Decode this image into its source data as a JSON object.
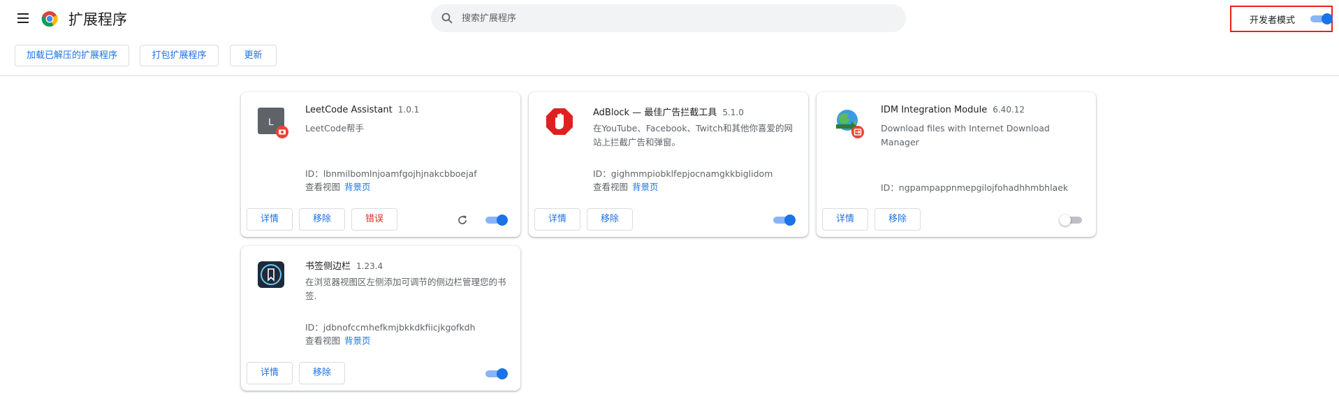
{
  "header": {
    "title": "扩展程序",
    "search_placeholder": "搜索扩展程序",
    "dev_mode_label": "开发者模式",
    "dev_mode_on": true
  },
  "toolbar": {
    "load_unpacked": "加载已解压的扩展程序",
    "pack": "打包扩展程序",
    "update": "更新"
  },
  "labels": {
    "details": "详情",
    "remove": "移除",
    "errors": "错误",
    "inspect_views": "查看视图",
    "background_page": "背景页"
  },
  "extensions": [
    {
      "name": "LeetCode Assistant",
      "version": "1.0.1",
      "description": "LeetCode帮手",
      "id": "ID：lbnmilbomlnjoamfgojhjnakcbboejaf",
      "enabled": true,
      "has_errors": true,
      "icon": "leetcode-icon"
    },
    {
      "name": "AdBlock — 最佳广告拦截工具",
      "version": "5.1.0",
      "description": "在YouTube、Facebook、Twitch和其他你喜爱的网站上拦截广告和弹窗。",
      "id": "ID：gighmmpiobklfepjocnamgkkbiglidom",
      "enabled": true,
      "icon": "adblock-hand-icon"
    },
    {
      "name": "IDM Integration Module",
      "version": "6.40.12",
      "description": "Download files with Internet Download Manager",
      "id": "ID：ngpampappnmepgilojfohadhhmbhlaek",
      "enabled": false,
      "icon": "idm-globe-icon"
    },
    {
      "name": "书签侧边栏",
      "version": "1.23.4",
      "description": "在浏览器视图区左侧添加可调节的侧边栏管理您的书签.",
      "id": "ID：jdbnofccmhefkmjbkkdkfiicjkgofkdh",
      "enabled": true,
      "icon": "bookmark-sidebar-icon"
    }
  ],
  "colors": {
    "accent": "#1a73e8",
    "error": "#d93025",
    "highlight_border": "#e8211c"
  }
}
